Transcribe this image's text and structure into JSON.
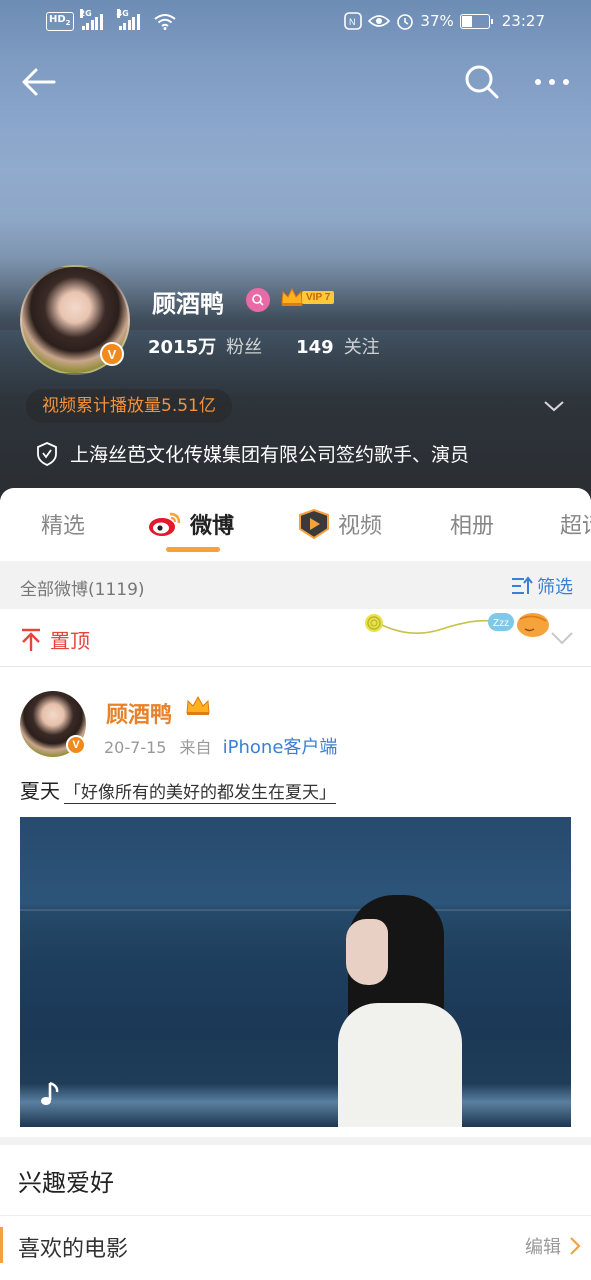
{
  "status_bar": {
    "hd": "HD",
    "hd_sub": "2",
    "signal1_tag": "2G",
    "signal2_tag": "4G",
    "battery": "37%",
    "time": "23:27"
  },
  "profile": {
    "name": "顾酒鸭",
    "vip_label": "VIP 7",
    "verified": "V",
    "followers_count": "2015万",
    "followers_label": "粉丝",
    "following_count": "149",
    "following_label": "关注",
    "video_play_total": "视频累计播放量5.51亿",
    "certification": "上海丝芭文化传媒集团有限公司签约歌手、演员"
  },
  "tabs": [
    {
      "label": "精选"
    },
    {
      "label": "微博"
    },
    {
      "label": "视频"
    },
    {
      "label": "相册"
    },
    {
      "label": "超话"
    }
  ],
  "feed_bar": {
    "all_posts": "全部微博(1119)",
    "filter": "筛选"
  },
  "pinned": {
    "label": "置顶"
  },
  "post": {
    "author": "顾酒鸭",
    "date": "20-7-15",
    "from": "来自",
    "source": "iPhone客户端",
    "text": "夏天",
    "topic": "「好像所有的美好的都发生在夏天」"
  },
  "interests": {
    "title": "兴趣爱好",
    "item": "喜欢的电影",
    "edit": "编辑"
  },
  "colors": {
    "accent_orange": "#f5a13c",
    "link_blue": "#3b7fd4",
    "pin_red": "#e5463b",
    "name_orange": "#e8822a"
  }
}
